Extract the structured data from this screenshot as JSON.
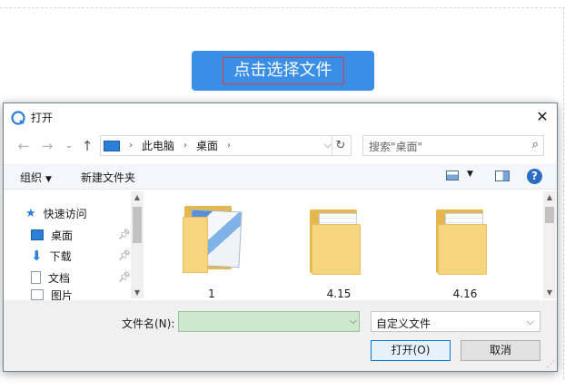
{
  "page": {
    "choose_button_label": "点击选择文件"
  },
  "dialog": {
    "title": "打开",
    "address": {
      "crumbs": [
        "此电脑",
        "桌面"
      ]
    },
    "search_placeholder": "搜索\"桌面\"",
    "toolbar": {
      "organize": "组织",
      "new_folder": "新建文件夹"
    },
    "nav": {
      "items": [
        {
          "label": "快速访问",
          "icon": "star-icon"
        },
        {
          "label": "桌面",
          "icon": "desktop-icon",
          "pinned": true
        },
        {
          "label": "下载",
          "icon": "download-icon",
          "pinned": true
        },
        {
          "label": "文档",
          "icon": "document-icon",
          "pinned": true
        },
        {
          "label": "图片",
          "icon": "picture-icon",
          "pinned": true
        }
      ]
    },
    "files": [
      {
        "name": "1"
      },
      {
        "name": "4.15"
      },
      {
        "name": "4.16"
      }
    ],
    "filename_label": "文件名(N):",
    "filename_value": "",
    "filetype_value": "自定义文件",
    "open_label": "打开(O)",
    "cancel_label": "取消"
  },
  "colors": {
    "accent": "#3a8ee6",
    "filename_bg": "#cde8cf",
    "folder": "#f6d57e"
  }
}
